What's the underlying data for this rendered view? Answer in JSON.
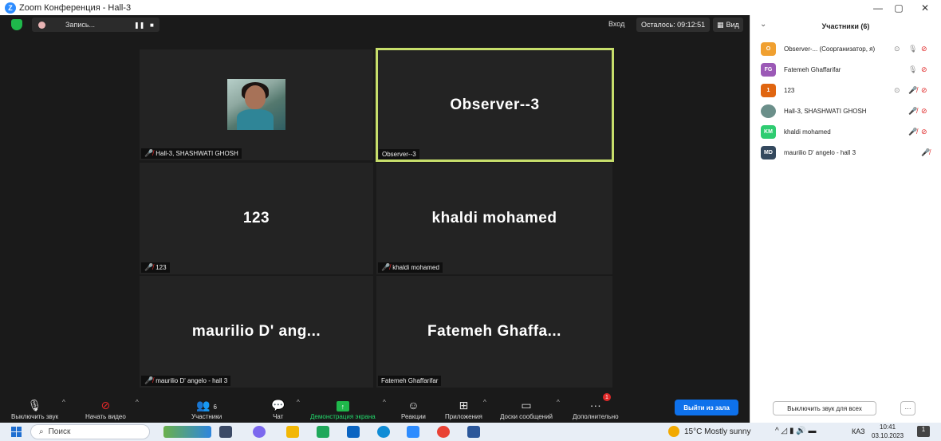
{
  "window": {
    "title": "Zoom Конференция - Hall-3",
    "logo_letter": "Z",
    "controls": [
      "—",
      "▢",
      "✕"
    ]
  },
  "topbar": {
    "recording_label": "Запись...",
    "pause_glyph": "❚❚",
    "stop_glyph": "■",
    "enter_label": "Вход",
    "time_remaining": "Осталось: 09:12:51",
    "view_label": "Вид"
  },
  "tiles": [
    {
      "big_name": "",
      "name_tag": "Hall-3, SHASHWATI GHOSH",
      "muted": true,
      "active": false,
      "has_photo": true
    },
    {
      "big_name": "Observer--3",
      "name_tag": "Observer--3",
      "muted": false,
      "active": true,
      "has_photo": false
    },
    {
      "big_name": "123",
      "name_tag": "123",
      "muted": true,
      "active": false,
      "has_photo": false
    },
    {
      "big_name": "khaldi mohamed",
      "name_tag": "khaldi mohamed",
      "muted": true,
      "active": false,
      "has_photo": false
    },
    {
      "big_name": "maurilio D' ang...",
      "name_tag": "maurilio D' angelo - hall 3",
      "muted": true,
      "active": false,
      "has_photo": false
    },
    {
      "big_name": "Fatemeh Ghaffa...",
      "name_tag": "Fatemeh Ghaffarifar",
      "muted": false,
      "active": false,
      "has_photo": false
    }
  ],
  "toolbar": {
    "mute": "Выключить звук",
    "video": "Начать видео",
    "participants": "Участники",
    "participants_count": "6",
    "chat": "Чат",
    "share": "Демонстрация экрана",
    "reactions": "Реакции",
    "apps": "Приложения",
    "whiteboards": "Доски сообщений",
    "more": "Дополнительно",
    "more_badge": "1",
    "leave": "Выйти из зала"
  },
  "panel": {
    "title": "Участники (6)",
    "participants": [
      {
        "initials": "O",
        "name": "Observer-... (Соорганизатор, я)",
        "color": "#f0a030"
      },
      {
        "initials": "FG",
        "name": "Fatemeh Ghaffarifar",
        "color": "#9b59b6"
      },
      {
        "initials": "1",
        "name": "123",
        "color": "#e06510"
      },
      {
        "initials": "",
        "name": "Hall-3, SHASHWATI GHOSH",
        "color": "#6b8f8a"
      },
      {
        "initials": "KM",
        "name": "khaldi mohamed",
        "color": "#2ecc71"
      },
      {
        "initials": "MD",
        "name": "maurilio D' angelo - hall 3",
        "color": "#34495e"
      }
    ],
    "mute_all": "Выключить звук для всех",
    "more": "···"
  },
  "taskbar": {
    "search": "Поиск",
    "weather": "15°C  Mostly sunny",
    "language": "КАЗ",
    "time": "10:41",
    "date": "03.10.2023",
    "notif_count": "1"
  }
}
